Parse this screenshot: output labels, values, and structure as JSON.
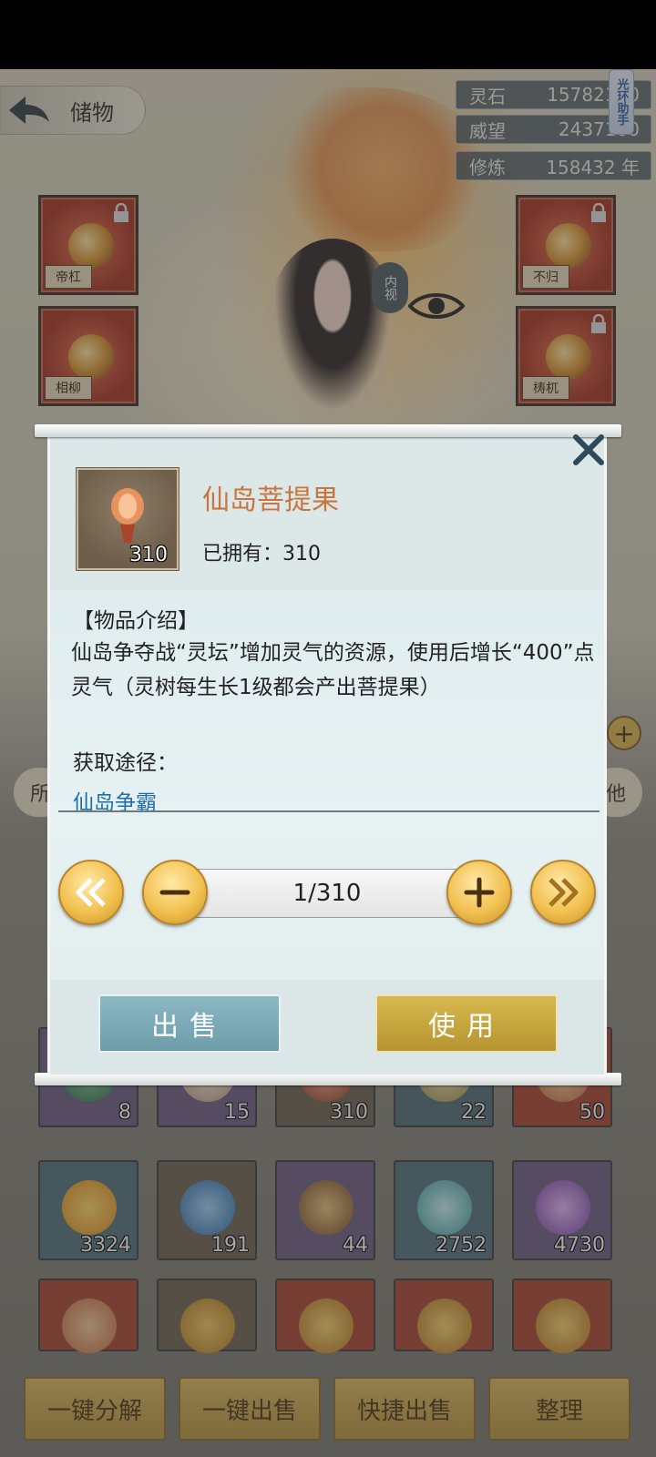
{
  "header": {
    "back_label": "储物"
  },
  "resources": [
    {
      "label": "灵石",
      "value": "15782170"
    },
    {
      "label": "威望",
      "value": "2437100"
    },
    {
      "label": "修炼",
      "value": "158432 年"
    }
  ],
  "helper": {
    "label": "光环助手"
  },
  "equipment": {
    "left": [
      {
        "seal": "帝杠"
      },
      {
        "seal": "相柳"
      }
    ],
    "right": [
      {
        "seal": "不归"
      },
      {
        "seal": "梼杌"
      }
    ]
  },
  "inner_view": {
    "label": "内视"
  },
  "side_tabs": {
    "left": "所",
    "right": "他"
  },
  "inventory": {
    "row1": [
      "8",
      "15",
      "310",
      "22",
      "50"
    ],
    "row2": [
      "3324",
      "191",
      "44",
      "2752",
      "4730"
    ]
  },
  "bottom_bar": [
    "一键分解",
    "一键出售",
    "快捷出售",
    "整理"
  ],
  "modal": {
    "item_name": "仙岛菩提果",
    "item_qty": "310",
    "owned": "已拥有：310",
    "desc_title": "【物品介绍】",
    "desc_text": "仙岛争夺战“灵坛”增加灵气的资源，使用后增长“400”点灵气（灵树每生长1级都会产出菩提果）",
    "source_title": "获取途径：",
    "source_link": "仙岛争霸",
    "quantity": "1/310",
    "sell_label": "出售",
    "use_label": "使用"
  },
  "colors": {
    "accent_gold": "#f2c150",
    "item_name": "#c8753f",
    "link": "#1f6fa8"
  }
}
